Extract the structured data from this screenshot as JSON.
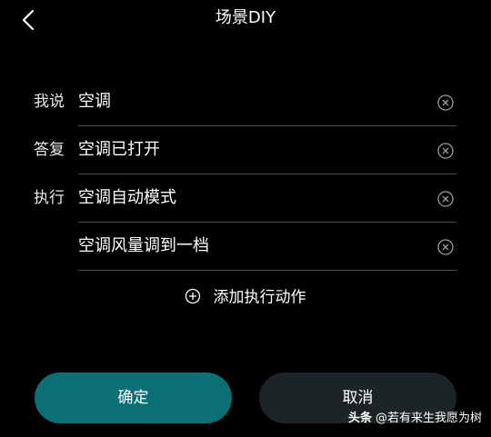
{
  "header": {
    "title": "场景DIY"
  },
  "rows": [
    {
      "label": "我说",
      "value": "空调"
    },
    {
      "label": "答复",
      "value": "空调已打开"
    },
    {
      "label": "执行",
      "value": "空调自动模式"
    },
    {
      "label": "",
      "value": "空调风量调到一档"
    }
  ],
  "add_action": {
    "label": "添加执行动作"
  },
  "buttons": {
    "confirm": "确定",
    "cancel": "取消"
  },
  "watermark": {
    "brand": "头条",
    "author": "@若有来生我愿为树"
  },
  "icons": {
    "back": "chevron-left-icon",
    "clear": "clear-circle-icon",
    "add": "plus-circle-icon"
  },
  "colors": {
    "background": "#000000",
    "confirm_button": "#0b6f76",
    "cancel_button": "#1c2426",
    "divider": "#4a4a4a"
  }
}
